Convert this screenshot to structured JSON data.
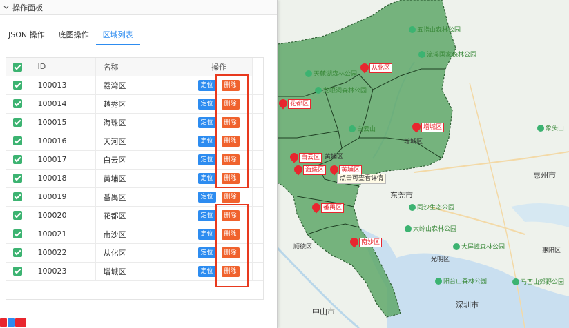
{
  "panel": {
    "title": "操作面板",
    "tabs": [
      {
        "label": "JSON 操作"
      },
      {
        "label": "底图操作"
      },
      {
        "label": "区域列表"
      }
    ]
  },
  "table": {
    "headers": {
      "id": "ID",
      "name": "名称",
      "actions": "操作"
    },
    "locate_label": "定位",
    "delete_label": "删除",
    "rows": [
      {
        "id": "100013",
        "name": "荔湾区"
      },
      {
        "id": "100014",
        "name": "越秀区"
      },
      {
        "id": "100015",
        "name": "海珠区"
      },
      {
        "id": "100016",
        "name": "天河区"
      },
      {
        "id": "100017",
        "name": "白云区"
      },
      {
        "id": "100018",
        "name": "黄埔区"
      },
      {
        "id": "100019",
        "name": "番禺区"
      },
      {
        "id": "100020",
        "name": "花都区"
      },
      {
        "id": "100021",
        "name": "南沙区"
      },
      {
        "id": "100022",
        "name": "从化区"
      },
      {
        "id": "100023",
        "name": "增城区"
      }
    ]
  },
  "map": {
    "markers": {
      "conghua": "从化区",
      "huadu": "花都区",
      "zengcheng": "增城区",
      "baiyun": "白云区",
      "haizhu": "海珠区",
      "huangpu": "黄埔区",
      "panyu": "番禺区",
      "nansha": "南沙区"
    },
    "tooltip": "点击可查看详情",
    "cities": {
      "dongguan": "东莞市",
      "huizhou": "惠州市",
      "zhongshan": "中山市",
      "shenzhen": "深圳市",
      "shunde": "顺德区",
      "huicheng": "惠阳区",
      "guangming": "光明区",
      "zengcheng_label": "增城区",
      "huangpu_label": "黄埔区",
      "baiyun_label": "白云山"
    },
    "pois": {
      "wuzhishan": "五指山森林公园",
      "liuxi": "流溪国家森林公园",
      "tianmu": "天麓湖森林公园",
      "xianghuoshan": "象头山",
      "tongsha": "同沙生态公园",
      "dalingshan": "大岭山森林公园",
      "daping": "大屏嶂森林公园",
      "yangtai": "阳台山森林公园",
      "maluan": "马峦山郊野公园",
      "wangniudun": "望牛墩",
      "longdong": "龙眼洞森林公园"
    },
    "colors": {
      "region_fill": "#5fa86a",
      "region_border": "#2f5f34",
      "sea": "#c9dff0",
      "marker": "#e8262e"
    }
  }
}
